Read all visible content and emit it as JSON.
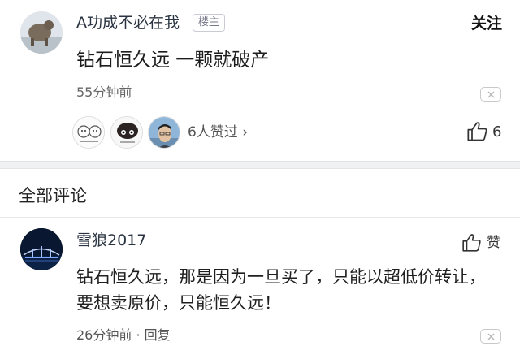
{
  "post": {
    "username": "A功成不必在我",
    "op_badge": "楼主",
    "follow_label": "关注",
    "text": "钻石恒久远 一颗就破产",
    "time": "55分钟前",
    "likers_text": "6人赞过 ›",
    "like_count": "6"
  },
  "comments_section": {
    "title": "全部评论"
  },
  "comment": {
    "username": "雪狼2017",
    "like_label": "赞",
    "text": "钻石恒久远，那是因为一旦买了，只能以超低价转让，要想卖原价，只能恒久远！",
    "time": "26分钟前 · 回复"
  },
  "icons": {
    "like": "thumbs-up-icon",
    "dismiss": "close-icon"
  },
  "colors": {
    "divider": "#f0f1f3",
    "text_primary": "#222222",
    "text_secondary": "#666666"
  }
}
